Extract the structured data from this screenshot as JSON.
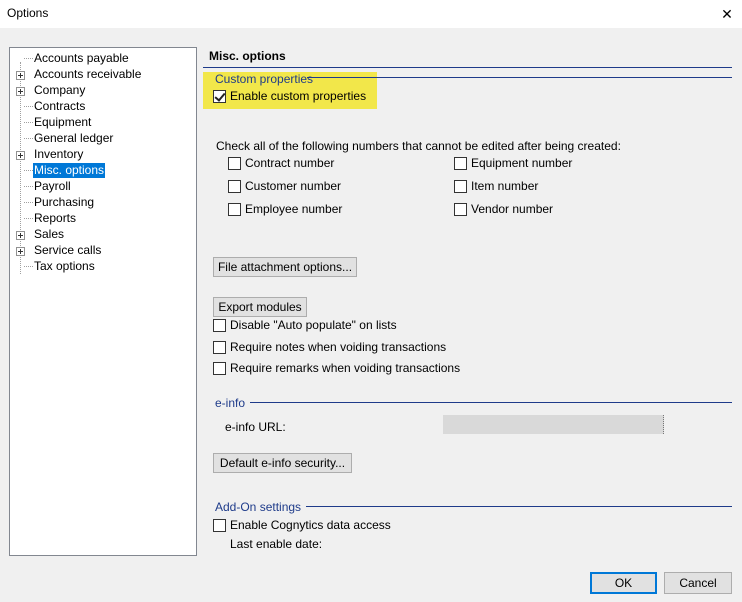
{
  "window": {
    "title": "Options",
    "close_glyph": "✕"
  },
  "tree": {
    "items": [
      {
        "label": "Accounts payable",
        "expandable": false,
        "selected": false
      },
      {
        "label": "Accounts receivable",
        "expandable": true,
        "selected": false
      },
      {
        "label": "Company",
        "expandable": true,
        "selected": false
      },
      {
        "label": "Contracts",
        "expandable": false,
        "selected": false
      },
      {
        "label": "Equipment",
        "expandable": false,
        "selected": false
      },
      {
        "label": "General ledger",
        "expandable": false,
        "selected": false
      },
      {
        "label": "Inventory",
        "expandable": true,
        "selected": false
      },
      {
        "label": "Misc. options",
        "expandable": false,
        "selected": true
      },
      {
        "label": "Payroll",
        "expandable": false,
        "selected": false
      },
      {
        "label": "Purchasing",
        "expandable": false,
        "selected": false
      },
      {
        "label": "Reports",
        "expandable": false,
        "selected": false
      },
      {
        "label": "Sales",
        "expandable": true,
        "selected": false
      },
      {
        "label": "Service calls",
        "expandable": true,
        "selected": false
      },
      {
        "label": "Tax options",
        "expandable": false,
        "selected": false
      }
    ]
  },
  "panel": {
    "title": "Misc. options",
    "custom_properties": {
      "group_label": "Custom properties",
      "enable_label": "Enable custom properties",
      "enable_checked": true
    },
    "numbers": {
      "prompt": "Check all of the following numbers that cannot be edited after being created:",
      "contract": "Contract number",
      "customer": "Customer number",
      "employee": "Employee number",
      "equipment": "Equipment number",
      "item": "Item number",
      "vendor": "Vendor number"
    },
    "file_attachment_button": "File attachment options...",
    "export_modules_button": "Export modules",
    "disable_auto_populate": "Disable \"Auto populate\" on lists",
    "require_notes": "Require notes when voiding transactions",
    "require_remarks": "Require remarks when voiding transactions",
    "einfo": {
      "group_label": "e-info",
      "url_label": "e-info URL:",
      "url_value": "",
      "security_button": "Default e-info security..."
    },
    "addon": {
      "group_label": "Add-On settings",
      "cognytics_label": "Enable Cognytics data access",
      "last_enable_label": "Last enable date:"
    }
  },
  "buttons": {
    "ok": "OK",
    "cancel": "Cancel"
  },
  "colors": {
    "selection": "#0078d7",
    "group_header": "#1e3b8a",
    "highlight": "#f2e74a"
  }
}
